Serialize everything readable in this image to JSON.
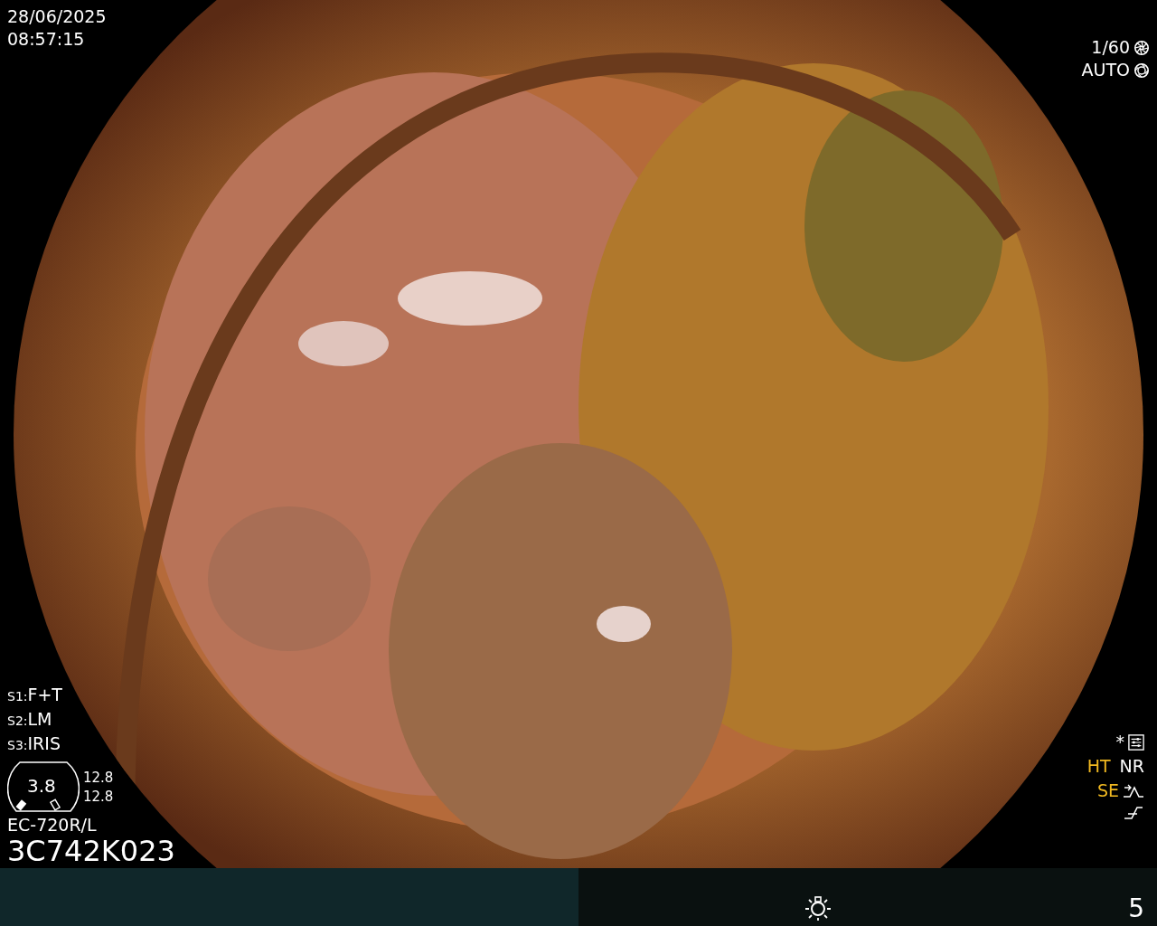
{
  "date": "28/06/2025",
  "time": "08:57:15",
  "shutter": "1/60",
  "iris_mode": "AUTO",
  "scope_settings": [
    {
      "key": "S1:",
      "value": "F+T"
    },
    {
      "key": "S2:",
      "value": "LM"
    },
    {
      "key": "S3:",
      "value": "IRIS"
    }
  ],
  "gauge": {
    "value": "3.8",
    "reading_1": "12.8",
    "reading_2": "12.8"
  },
  "scope_model": "EC-720R/L",
  "serial": "3C742K023",
  "star_mark": "*",
  "indicators": [
    {
      "label": "HT",
      "on": true
    },
    {
      "label": "NR",
      "on": false
    },
    {
      "label": "SE",
      "on": true
    }
  ],
  "bottom_bar": {
    "level_number": "5"
  }
}
